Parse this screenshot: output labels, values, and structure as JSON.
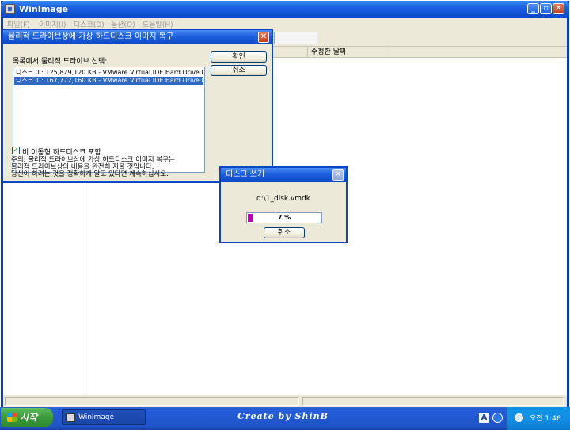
{
  "window": {
    "title": "WinImage",
    "min_label": "_",
    "max_label": "▫",
    "close_label": "✕"
  },
  "menu": [
    "파일(F)",
    "이미지(I)",
    "디스크(D)",
    "옵션(O)",
    "도움말(H)"
  ],
  "list_header": {
    "col_modified": "수정한 날짜"
  },
  "restore_dialog": {
    "title": "물리적 드라이브상에 가상 하드디스크 이미지 복구",
    "select_label": "목록에서 물리적 드라이브 선택:",
    "drives": [
      "디스크 0 : 125,829,120 KB - VMware Virtual IDE Hard Drive 00",
      "디스크 1 : 167,772,160 KB - VMware Virtual IDE Hard Drive 00"
    ],
    "selected_index": 1,
    "ok_label": "확인",
    "cancel_label": "취소",
    "checkbox_label": "비 이동형 하드디스크 포함",
    "checkbox_checked": true,
    "note_lines": [
      "주의: 물리적 드라이브상에 가상 하드디스크 이미지 복구는",
      "물리적 드라이브상의 내용을 완전히 지울 것입니다.",
      "당신이 하려는 것을 정확하게 알고 있다면 계속하십시오."
    ]
  },
  "write_dialog": {
    "title": "디스크 쓰기",
    "filename": "d:\\1_disk.vmdk",
    "progress_percent": 7,
    "progress_label": "7 %",
    "cancel_label": "취소",
    "progress_color": "#c000c0"
  },
  "taskbar": {
    "start_label": "시작",
    "task_label": "WinImage",
    "watermark": "Create by ShinB",
    "lang_indicator": "A",
    "clock": "오전 1:46"
  }
}
